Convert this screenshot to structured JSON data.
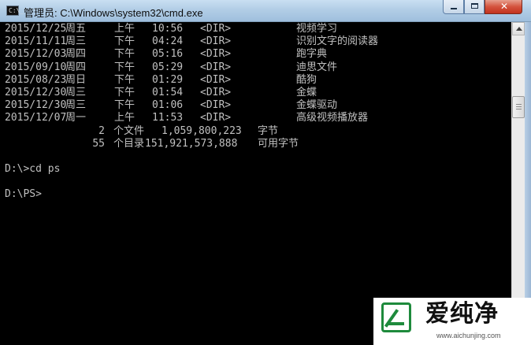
{
  "window": {
    "icon_text": "C:\\_",
    "title": "管理员: C:\\Windows\\system32\\cmd.exe",
    "buttons": {
      "minimize": "minimize",
      "maximize": "maximize",
      "close": "✕"
    }
  },
  "listing": [
    {
      "date": "2015/12/25",
      "weekday": "周五",
      "ampm": "上午",
      "time": "10:56",
      "type": "<DIR>",
      "name": "视频学习"
    },
    {
      "date": "2015/11/11",
      "weekday": "周三",
      "ampm": "下午",
      "time": "04:24",
      "type": "<DIR>",
      "name": "识别文字的阅读器"
    },
    {
      "date": "2015/12/03",
      "weekday": "周四",
      "ampm": "下午",
      "time": "05:16",
      "type": "<DIR>",
      "name": "跑字典"
    },
    {
      "date": "2015/09/10",
      "weekday": "周四",
      "ampm": "下午",
      "time": "05:29",
      "type": "<DIR>",
      "name": "迪思文件"
    },
    {
      "date": "2015/08/23",
      "weekday": "周日",
      "ampm": "下午",
      "time": "01:29",
      "type": "<DIR>",
      "name": "酷狗"
    },
    {
      "date": "2015/12/30",
      "weekday": "周三",
      "ampm": "下午",
      "time": "01:54",
      "type": "<DIR>",
      "name": "金蝶"
    },
    {
      "date": "2015/12/30",
      "weekday": "周三",
      "ampm": "下午",
      "time": "01:06",
      "type": "<DIR>",
      "name": "金蝶驱动"
    },
    {
      "date": "2015/12/07",
      "weekday": "周一",
      "ampm": "上午",
      "time": "11:53",
      "type": "<DIR>",
      "name": "高级视频播放器"
    }
  ],
  "summary": {
    "files": {
      "count": "2",
      "label": "个文件",
      "size": "1,059,800,223",
      "unit": "字节"
    },
    "dirs": {
      "count": "55",
      "label": "个目录",
      "size": "151,921,573,888",
      "unit": "可用字节"
    }
  },
  "commands": [
    {
      "text": "D:\\>cd ps"
    },
    {
      "text": "D:\\PS>"
    }
  ],
  "watermark": {
    "name": "爱纯净",
    "url": "www.aichunjing.com",
    "accent": "#1e8a3c"
  },
  "colors": {
    "console_bg": "#000000",
    "console_fg": "#c0c0c0"
  }
}
